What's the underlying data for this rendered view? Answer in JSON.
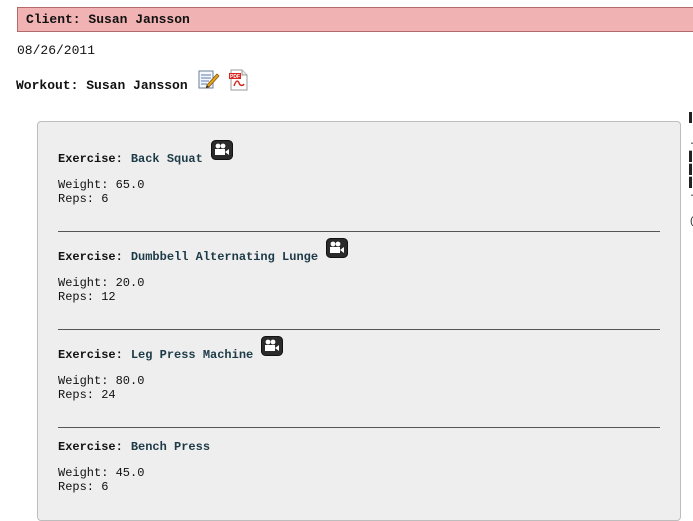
{
  "client": {
    "label": "Client:",
    "name": "Susan Jansson"
  },
  "date": "08/26/2011",
  "workout": {
    "label": "Workout:",
    "name": "Susan Jansson",
    "edit_icon": "edit-notes-icon",
    "pdf_icon": "pdf-icon"
  },
  "exercises": [
    {
      "label": "Exercise:",
      "name": "Back Squat",
      "weight": "Weight: 65.0",
      "reps": "Reps: 6",
      "has_video": true
    },
    {
      "label": "Exercise:",
      "name": "Dumbbell Alternating Lunge",
      "weight": "Weight: 20.0",
      "reps": "Reps: 12",
      "has_video": true
    },
    {
      "label": "Exercise:",
      "name": "Leg Press Machine",
      "weight": "Weight: 80.0",
      "reps": "Reps: 24",
      "has_video": true
    },
    {
      "label": "Exercise:",
      "name": "Bench Press",
      "weight": "Weight: 45.0",
      "reps": "Reps: 6",
      "has_video": false
    }
  ],
  "colors": {
    "client_bar_bg": "#f0b2b2",
    "client_bar_border": "#b36a6a",
    "panel_bg": "#eeeeee",
    "exercise_name": "#1d3a47"
  }
}
